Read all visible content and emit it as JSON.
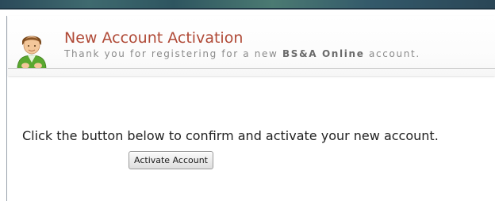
{
  "header": {
    "title": "New Account Activation",
    "subtitle_prefix": "Thank you for registering for a new ",
    "subtitle_brand": "BS&A Online",
    "subtitle_suffix": " account.",
    "avatar_icon": "user-avatar-icon"
  },
  "main": {
    "instruction": "Click the button below to confirm and activate your new account.",
    "activate_button_label": "Activate Account"
  },
  "colors": {
    "title": "#b04a37",
    "subtitle": "#8a8a8a",
    "body_text": "#222222"
  }
}
